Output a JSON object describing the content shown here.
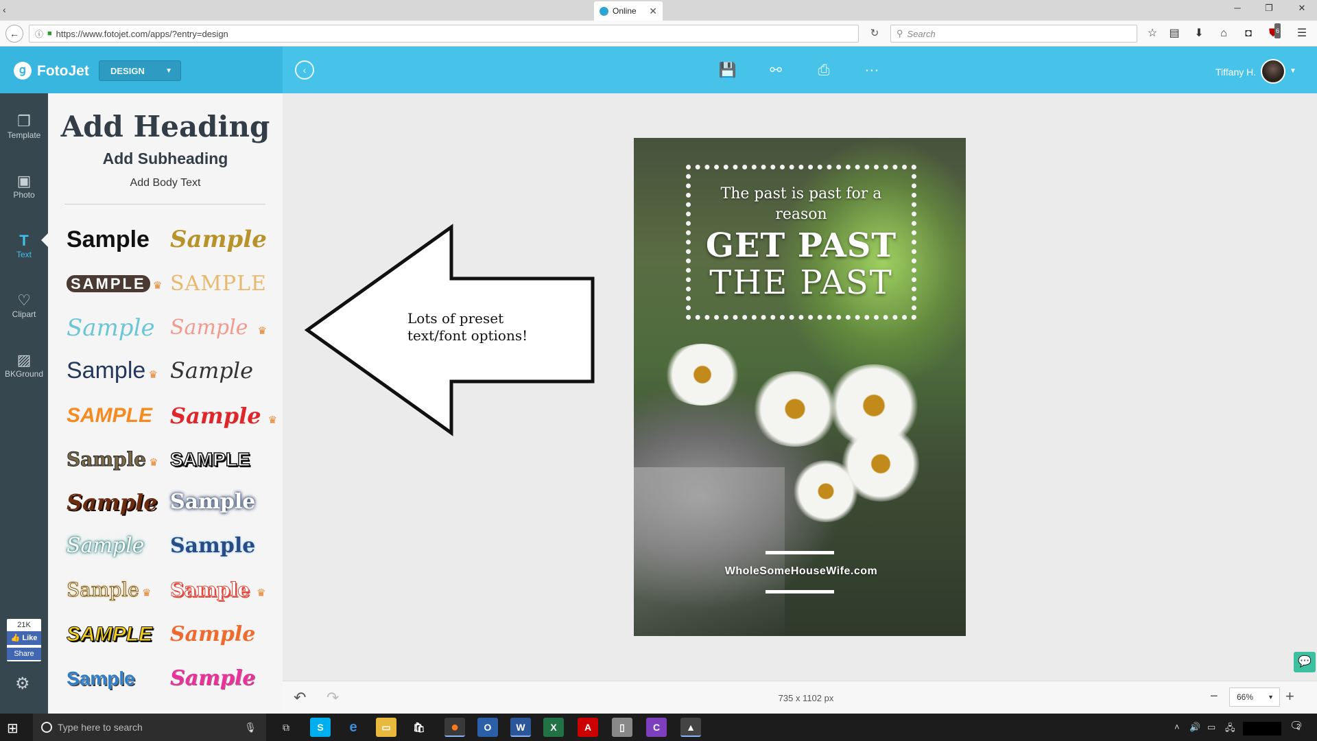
{
  "browser": {
    "tab_title": "Online",
    "url": "https://www.fotojet.com/apps/?entry=design",
    "search_placeholder": "Search",
    "ublock_count": "6"
  },
  "app": {
    "logo": "FotoJet",
    "mode_dropdown": "DESIGN",
    "user_name": "Tiffany H."
  },
  "rail": {
    "items": [
      {
        "label": "Template"
      },
      {
        "label": "Photo"
      },
      {
        "label": "Text"
      },
      {
        "label": "Clipart"
      },
      {
        "label": "BKGround"
      }
    ],
    "fb_count": "21K",
    "fb_like": "Like",
    "fb_share": "Share"
  },
  "panel": {
    "add_heading": "Add Heading",
    "add_subheading": "Add Subheading",
    "add_body": "Add Body Text",
    "samples": [
      {
        "text": "Sample",
        "color": "#111111",
        "premium": false
      },
      {
        "text": "Sample",
        "color": "#b8922a",
        "premium": false
      },
      {
        "text": "SAMPLE",
        "color": "#4a3a33",
        "premium": true
      },
      {
        "text": "SAMPLE",
        "color": "#e8b86d",
        "premium": false
      },
      {
        "text": "Sample",
        "color": "#6cc6d6",
        "premium": false
      },
      {
        "text": "Sample",
        "color": "#f39a8e",
        "premium": true
      },
      {
        "text": "Sample",
        "color": "#24385e",
        "premium": true
      },
      {
        "text": "Sample",
        "color": "#333333",
        "premium": false
      },
      {
        "text": "SAMPLE",
        "color": "#f58a1f",
        "premium": false
      },
      {
        "text": "Sample",
        "color": "#e0262b",
        "premium": true
      },
      {
        "text": "Sample",
        "color": "#7a6a48",
        "premium": true
      },
      {
        "text": "SAMPLE",
        "color": "#111111",
        "premium": false
      },
      {
        "text": "Sample",
        "color": "#6b2b10",
        "premium": false
      },
      {
        "text": "Sample",
        "color": "#5a7fbf",
        "premium": false
      },
      {
        "text": "Sample",
        "color": "#2cb5b0",
        "premium": false
      },
      {
        "text": "Sample",
        "color": "#2a4a88",
        "premium": false
      },
      {
        "text": "Sample",
        "color": "#e2b24a",
        "premium": true
      },
      {
        "text": "Sample",
        "color": "#e4473b",
        "premium": true
      },
      {
        "text": "SAMPLE",
        "color": "#f4d01a",
        "premium": false
      },
      {
        "text": "Sample",
        "color": "#ef6a2e",
        "premium": false
      },
      {
        "text": "Sample",
        "color": "#2f7ec9",
        "premium": false
      },
      {
        "text": "Sample",
        "color": "#e8329a",
        "premium": false
      }
    ]
  },
  "canvas": {
    "size_label": "735 x 1102 px",
    "zoom": "66%"
  },
  "poster": {
    "line1": "The past is past for a",
    "line2": "reason",
    "big1": "GET PAST",
    "big2": "THE PAST",
    "url": "WholeSomeHouseWife.com"
  },
  "annotation": {
    "text": "Lots of preset\ntext/font options!"
  },
  "taskbar": {
    "search_placeholder": "Type here to search",
    "notif_count": "2"
  }
}
